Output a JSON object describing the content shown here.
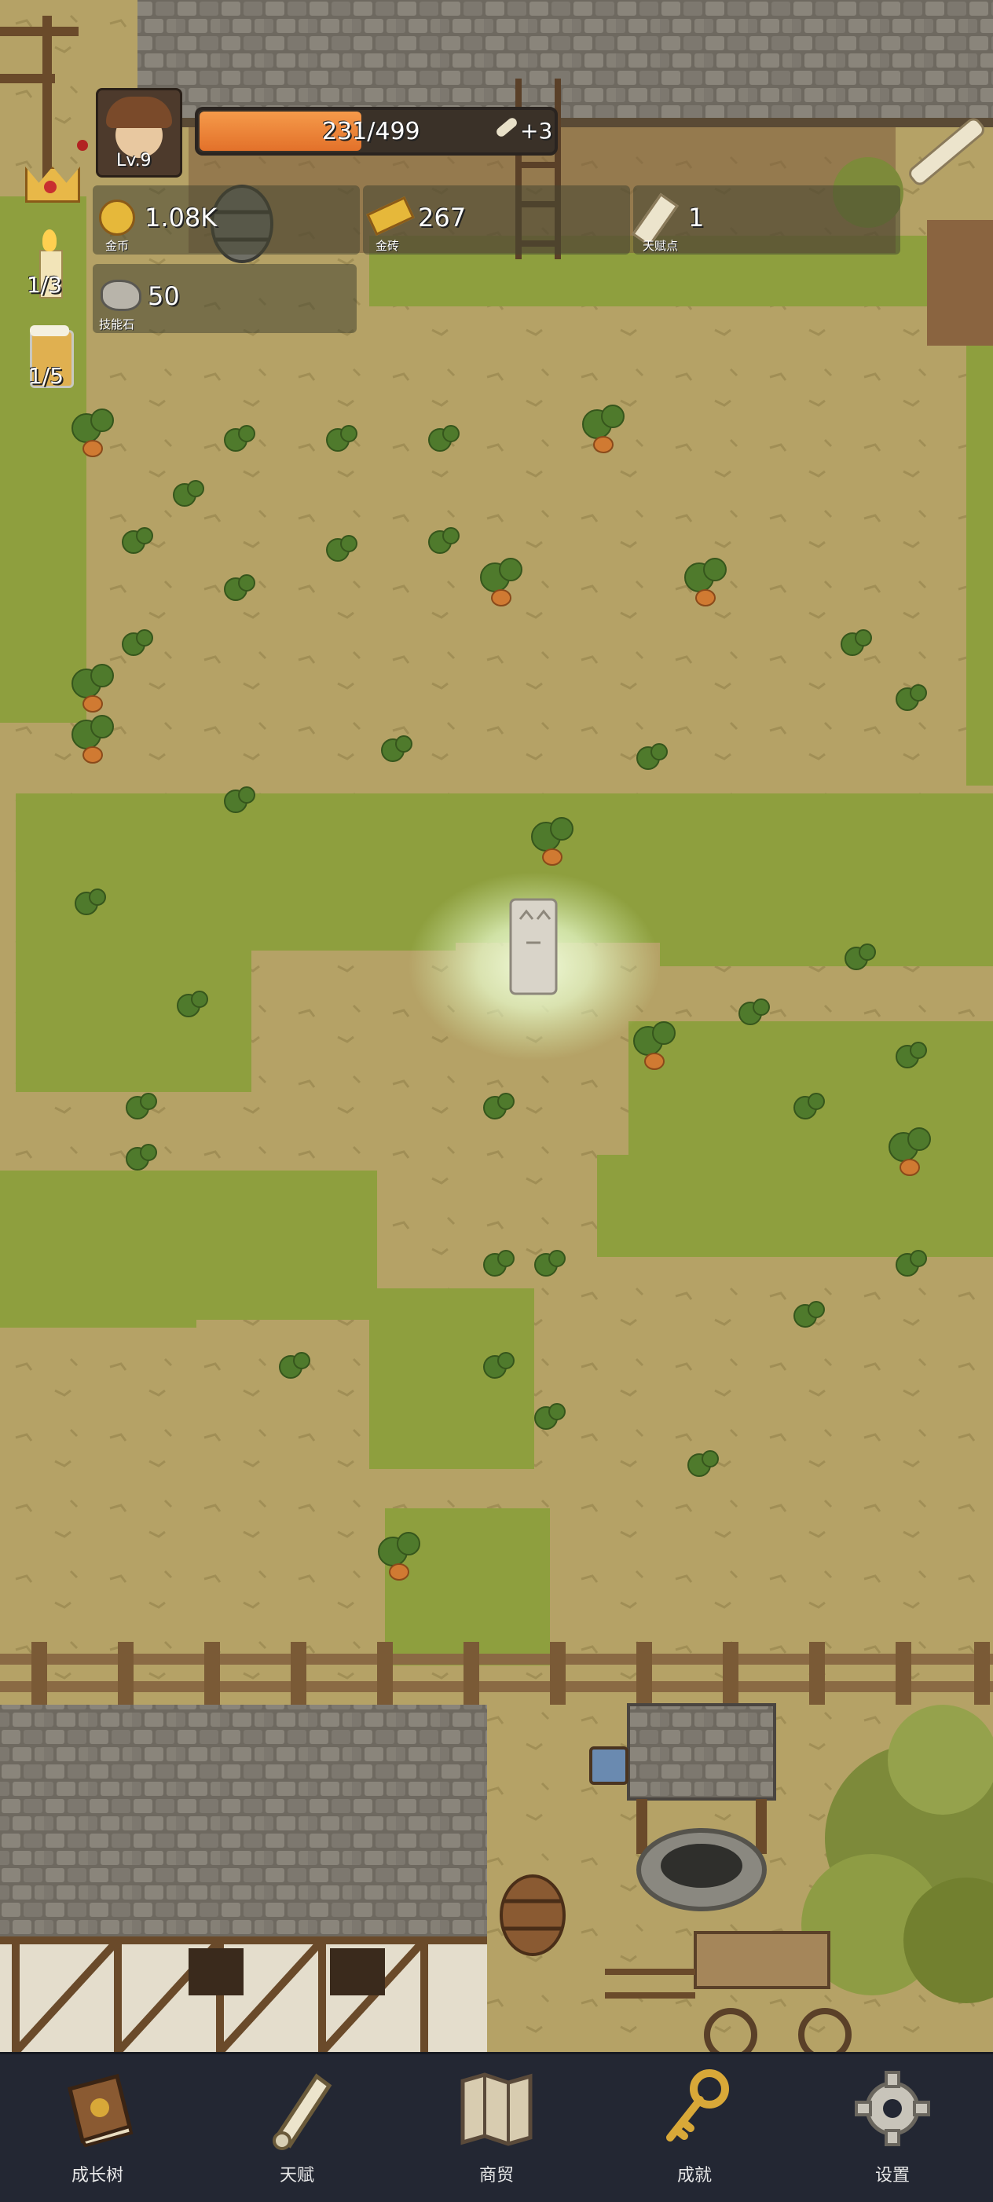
{
  "player": {
    "level": "Lv.9",
    "xp_text": "231/499",
    "xp_fraction": 0.463,
    "xp_bonus": "+3"
  },
  "resources": [
    {
      "id": "gold",
      "icon": "gold-coin-icon",
      "value": "1.08K",
      "label": "金币"
    },
    {
      "id": "gold-brick",
      "icon": "gold-brick-icon",
      "value": "267",
      "label": "金砖"
    },
    {
      "id": "talent-point",
      "icon": "scroll-icon",
      "value": "1",
      "label": "天赋点"
    },
    {
      "id": "skill-stone",
      "icon": "stone-icon",
      "value": "50",
      "label": "技能石"
    }
  ],
  "side_counters": [
    {
      "icon": "candle-icon",
      "value": "1/3"
    },
    {
      "icon": "beer-mug-icon",
      "value": "1/5"
    }
  ],
  "nav": [
    {
      "label": "成长树",
      "icon": "book-icon"
    },
    {
      "label": "天赋",
      "icon": "scroll-icon"
    },
    {
      "label": "商贸",
      "icon": "map-icon"
    },
    {
      "label": "成就",
      "icon": "key-icon"
    },
    {
      "label": "设置",
      "icon": "gear-icon"
    }
  ],
  "colors": {
    "soil": "#b5a266",
    "grass": "#8e9f3e",
    "roof": "#6e6960",
    "nav_bg": "#232733",
    "xp_fill": "#e3712a"
  }
}
